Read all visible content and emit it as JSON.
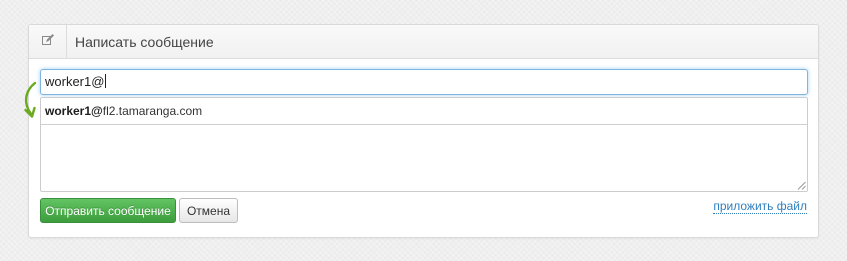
{
  "panel": {
    "title": "Написать сообщение",
    "header_icon": "compose-icon"
  },
  "recipient": {
    "value": "worker1@"
  },
  "suggestions": [
    {
      "match": "worker1@",
      "rest": "fl2.tamaranga.com"
    }
  ],
  "message": {
    "value": ""
  },
  "actions": {
    "send_label": "Отправить сообщение",
    "cancel_label": "Отмена",
    "attach_label": "приложить файл"
  },
  "colors": {
    "send_button": "#4cae4c",
    "link": "#2f7fbf",
    "focus_border": "#7fb6e0",
    "annotation_arrow": "#6aaa1e"
  }
}
